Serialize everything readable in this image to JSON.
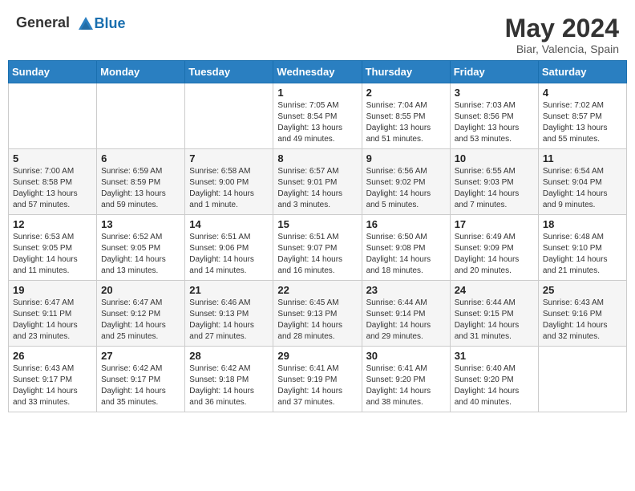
{
  "header": {
    "logo_general": "General",
    "logo_blue": "Blue",
    "month_year": "May 2024",
    "location": "Biar, Valencia, Spain"
  },
  "weekdays": [
    "Sunday",
    "Monday",
    "Tuesday",
    "Wednesday",
    "Thursday",
    "Friday",
    "Saturday"
  ],
  "weeks": [
    [
      {
        "day": "",
        "sunrise": "",
        "sunset": "",
        "daylight": ""
      },
      {
        "day": "",
        "sunrise": "",
        "sunset": "",
        "daylight": ""
      },
      {
        "day": "",
        "sunrise": "",
        "sunset": "",
        "daylight": ""
      },
      {
        "day": "1",
        "sunrise": "Sunrise: 7:05 AM",
        "sunset": "Sunset: 8:54 PM",
        "daylight": "Daylight: 13 hours and 49 minutes."
      },
      {
        "day": "2",
        "sunrise": "Sunrise: 7:04 AM",
        "sunset": "Sunset: 8:55 PM",
        "daylight": "Daylight: 13 hours and 51 minutes."
      },
      {
        "day": "3",
        "sunrise": "Sunrise: 7:03 AM",
        "sunset": "Sunset: 8:56 PM",
        "daylight": "Daylight: 13 hours and 53 minutes."
      },
      {
        "day": "4",
        "sunrise": "Sunrise: 7:02 AM",
        "sunset": "Sunset: 8:57 PM",
        "daylight": "Daylight: 13 hours and 55 minutes."
      }
    ],
    [
      {
        "day": "5",
        "sunrise": "Sunrise: 7:00 AM",
        "sunset": "Sunset: 8:58 PM",
        "daylight": "Daylight: 13 hours and 57 minutes."
      },
      {
        "day": "6",
        "sunrise": "Sunrise: 6:59 AM",
        "sunset": "Sunset: 8:59 PM",
        "daylight": "Daylight: 13 hours and 59 minutes."
      },
      {
        "day": "7",
        "sunrise": "Sunrise: 6:58 AM",
        "sunset": "Sunset: 9:00 PM",
        "daylight": "Daylight: 14 hours and 1 minute."
      },
      {
        "day": "8",
        "sunrise": "Sunrise: 6:57 AM",
        "sunset": "Sunset: 9:01 PM",
        "daylight": "Daylight: 14 hours and 3 minutes."
      },
      {
        "day": "9",
        "sunrise": "Sunrise: 6:56 AM",
        "sunset": "Sunset: 9:02 PM",
        "daylight": "Daylight: 14 hours and 5 minutes."
      },
      {
        "day": "10",
        "sunrise": "Sunrise: 6:55 AM",
        "sunset": "Sunset: 9:03 PM",
        "daylight": "Daylight: 14 hours and 7 minutes."
      },
      {
        "day": "11",
        "sunrise": "Sunrise: 6:54 AM",
        "sunset": "Sunset: 9:04 PM",
        "daylight": "Daylight: 14 hours and 9 minutes."
      }
    ],
    [
      {
        "day": "12",
        "sunrise": "Sunrise: 6:53 AM",
        "sunset": "Sunset: 9:05 PM",
        "daylight": "Daylight: 14 hours and 11 minutes."
      },
      {
        "day": "13",
        "sunrise": "Sunrise: 6:52 AM",
        "sunset": "Sunset: 9:05 PM",
        "daylight": "Daylight: 14 hours and 13 minutes."
      },
      {
        "day": "14",
        "sunrise": "Sunrise: 6:51 AM",
        "sunset": "Sunset: 9:06 PM",
        "daylight": "Daylight: 14 hours and 14 minutes."
      },
      {
        "day": "15",
        "sunrise": "Sunrise: 6:51 AM",
        "sunset": "Sunset: 9:07 PM",
        "daylight": "Daylight: 14 hours and 16 minutes."
      },
      {
        "day": "16",
        "sunrise": "Sunrise: 6:50 AM",
        "sunset": "Sunset: 9:08 PM",
        "daylight": "Daylight: 14 hours and 18 minutes."
      },
      {
        "day": "17",
        "sunrise": "Sunrise: 6:49 AM",
        "sunset": "Sunset: 9:09 PM",
        "daylight": "Daylight: 14 hours and 20 minutes."
      },
      {
        "day": "18",
        "sunrise": "Sunrise: 6:48 AM",
        "sunset": "Sunset: 9:10 PM",
        "daylight": "Daylight: 14 hours and 21 minutes."
      }
    ],
    [
      {
        "day": "19",
        "sunrise": "Sunrise: 6:47 AM",
        "sunset": "Sunset: 9:11 PM",
        "daylight": "Daylight: 14 hours and 23 minutes."
      },
      {
        "day": "20",
        "sunrise": "Sunrise: 6:47 AM",
        "sunset": "Sunset: 9:12 PM",
        "daylight": "Daylight: 14 hours and 25 minutes."
      },
      {
        "day": "21",
        "sunrise": "Sunrise: 6:46 AM",
        "sunset": "Sunset: 9:13 PM",
        "daylight": "Daylight: 14 hours and 27 minutes."
      },
      {
        "day": "22",
        "sunrise": "Sunrise: 6:45 AM",
        "sunset": "Sunset: 9:13 PM",
        "daylight": "Daylight: 14 hours and 28 minutes."
      },
      {
        "day": "23",
        "sunrise": "Sunrise: 6:44 AM",
        "sunset": "Sunset: 9:14 PM",
        "daylight": "Daylight: 14 hours and 29 minutes."
      },
      {
        "day": "24",
        "sunrise": "Sunrise: 6:44 AM",
        "sunset": "Sunset: 9:15 PM",
        "daylight": "Daylight: 14 hours and 31 minutes."
      },
      {
        "day": "25",
        "sunrise": "Sunrise: 6:43 AM",
        "sunset": "Sunset: 9:16 PM",
        "daylight": "Daylight: 14 hours and 32 minutes."
      }
    ],
    [
      {
        "day": "26",
        "sunrise": "Sunrise: 6:43 AM",
        "sunset": "Sunset: 9:17 PM",
        "daylight": "Daylight: 14 hours and 33 minutes."
      },
      {
        "day": "27",
        "sunrise": "Sunrise: 6:42 AM",
        "sunset": "Sunset: 9:17 PM",
        "daylight": "Daylight: 14 hours and 35 minutes."
      },
      {
        "day": "28",
        "sunrise": "Sunrise: 6:42 AM",
        "sunset": "Sunset: 9:18 PM",
        "daylight": "Daylight: 14 hours and 36 minutes."
      },
      {
        "day": "29",
        "sunrise": "Sunrise: 6:41 AM",
        "sunset": "Sunset: 9:19 PM",
        "daylight": "Daylight: 14 hours and 37 minutes."
      },
      {
        "day": "30",
        "sunrise": "Sunrise: 6:41 AM",
        "sunset": "Sunset: 9:20 PM",
        "daylight": "Daylight: 14 hours and 38 minutes."
      },
      {
        "day": "31",
        "sunrise": "Sunrise: 6:40 AM",
        "sunset": "Sunset: 9:20 PM",
        "daylight": "Daylight: 14 hours and 40 minutes."
      },
      {
        "day": "",
        "sunrise": "",
        "sunset": "",
        "daylight": ""
      }
    ]
  ]
}
